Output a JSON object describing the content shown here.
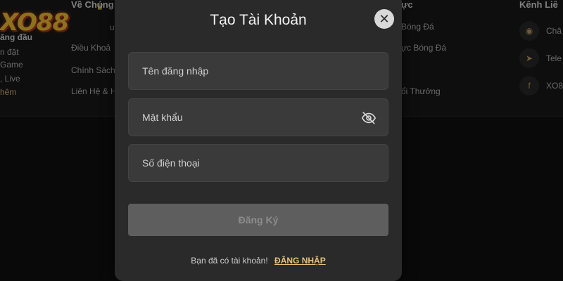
{
  "background": {
    "logo_text": "XO88",
    "left_column": [
      "ăng đầu",
      "n đặt",
      "Game",
      ", Live",
      "hêm"
    ],
    "about": {
      "heading": "Về Chúng",
      "items": [
        "u",
        "Điều Khoả",
        "Chính Sách",
        "Liên Hệ & H"
      ]
    },
    "category": {
      "heading": "ực",
      "items": [
        "Bóng Đá",
        "ực Bóng Đá",
        "",
        "ổi Thưởng"
      ]
    },
    "channels": {
      "heading": "Kênh Liê",
      "items": [
        {
          "icon": "eye-icon",
          "glyph": "◉",
          "label": "Châ"
        },
        {
          "icon": "telegram-icon",
          "glyph": "➤",
          "label": "Tele"
        },
        {
          "icon": "facebook-icon",
          "glyph": "f",
          "label": "XO8"
        }
      ]
    }
  },
  "modal": {
    "title": "Tạo Tài Khoản",
    "close_glyph": "✕",
    "fields": {
      "username_placeholder": "Tên đăng nhập",
      "password_placeholder": "Mật khẩu",
      "phone_placeholder": "Số điện thoại"
    },
    "submit_label": "Đăng Ký",
    "footer_text": "Bạn đã có tài khoản!",
    "login_link": "ĐĂNG NHẬP"
  },
  "colors": {
    "modal_bg": "#2a2a2a",
    "field_bg": "#3a3a3a",
    "button_bg": "#5e5e5e",
    "link": "#e6c17a"
  }
}
